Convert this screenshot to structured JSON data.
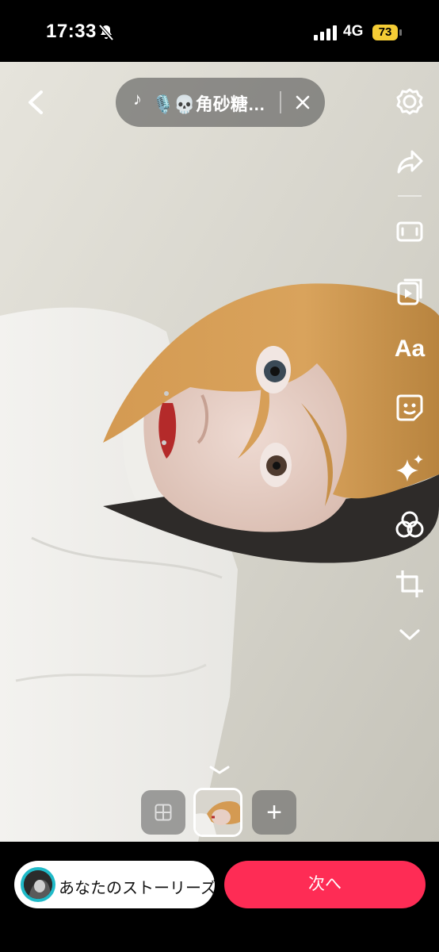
{
  "status_bar": {
    "time": "17:33",
    "network": "4G",
    "battery": "73",
    "icons": [
      "silent-bell-icon",
      "signal-bars-icon",
      "battery-icon"
    ]
  },
  "editor": {
    "music": {
      "title": "🎙️💀角砂糖…",
      "icons": [
        "music-note-icon",
        "close-icon"
      ]
    },
    "back_icon": "chevron-left-icon",
    "tools": [
      {
        "name": "settings",
        "icon": "gear-icon"
      },
      {
        "name": "share",
        "icon": "share-arrow-icon"
      },
      {
        "name": "aspect",
        "icon": "frame-icon"
      },
      {
        "name": "templates",
        "icon": "video-play-icon"
      },
      {
        "name": "text",
        "label": "Aa"
      },
      {
        "name": "stickers",
        "icon": "sticker-icon"
      },
      {
        "name": "effects",
        "icon": "sparkle-icon"
      },
      {
        "name": "filters",
        "icon": "filter-circles-icon"
      },
      {
        "name": "crop",
        "icon": "crop-icon"
      },
      {
        "name": "more",
        "icon": "chevron-down-icon"
      }
    ],
    "thumbnails": {
      "grid_icon": "grid-icon",
      "add_label": "+",
      "collapse_icon": "chevron-down-icon"
    }
  },
  "bottom": {
    "story_label": "あなたのストーリーズ",
    "next_label": "次へ"
  },
  "colors": {
    "accent": "#fe2c55",
    "battery": "#f4cc35",
    "avatar_ring": "#1fbac8"
  }
}
